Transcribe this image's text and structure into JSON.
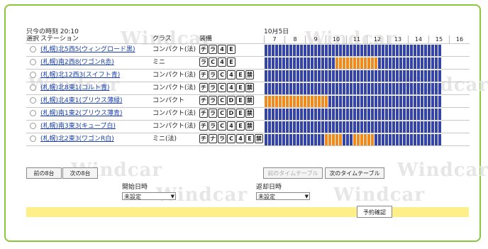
{
  "time_label": "只今の時刻",
  "time_value": "20:10",
  "date_label": "10月5日",
  "headers": {
    "select": "選択",
    "station": "ステーション",
    "class": "クラス",
    "equipment": "装備"
  },
  "hours": [
    "7",
    "8",
    "9",
    "10",
    "11",
    "12",
    "13",
    "14",
    "15",
    "16"
  ],
  "rows": [
    {
      "station": "(札幌)北5西5(ウィングロード黒)",
      "class": "コンパクト(法)",
      "eq": [
        "チ",
        "ラ",
        "4",
        "E"
      ],
      "res": []
    },
    {
      "station": "(札幌)南2西8(ワゴンR赤)",
      "class": "ミニ",
      "eq": [
        "ラ",
        "C",
        "4",
        "E"
      ],
      "res": [
        [
          20,
          32
        ]
      ]
    },
    {
      "station": "(札幌)北12西3(スイフト青)",
      "class": "コンパクト(法)",
      "eq": [
        "チ",
        "ラ",
        "C",
        "4",
        "E",
        "禁"
      ],
      "res": []
    },
    {
      "station": "(札幌)北8東1(コルト青)",
      "class": "コンパクト(法)",
      "eq": [
        "チ",
        "ラ",
        "C",
        "4",
        "E",
        "禁"
      ],
      "res": []
    },
    {
      "station": "(札幌)北4東1(プリウス薄緑)",
      "class": "コンパクト",
      "eq": [
        "チ",
        "ラ",
        "C",
        "D",
        "E",
        "禁"
      ],
      "res": [
        [
          0,
          18
        ]
      ]
    },
    {
      "station": "(札幌)南1東2(プリウス薄青)",
      "class": "コンパクト(法)",
      "eq": [
        "チ",
        "ラ",
        "C",
        "D",
        "E",
        "禁"
      ],
      "res": []
    },
    {
      "station": "(札幌)南3東3(キューブ白)",
      "class": "コンパクト(法)",
      "eq": [
        "チ",
        "ラ",
        "C",
        "4",
        "E",
        "禁"
      ],
      "res": []
    },
    {
      "station": "(札幌)北2東3(ワゴンR白)",
      "class": "ミニ(法)",
      "eq": [
        "チ",
        "ナ",
        "ラ",
        "C",
        "4",
        "E",
        "禁"
      ],
      "res": [
        [
          17,
          22
        ],
        [
          25,
          31
        ]
      ]
    }
  ],
  "buttons": {
    "prev8": "前の8台",
    "next8": "次の8台",
    "prev_tt": "前のタイムテーブル",
    "next_tt": "次のタイムテーブル",
    "confirm": "予約確認"
  },
  "start_label": "開始日時",
  "return_label": "返却日時",
  "start_select": "未設定",
  "return_select": "未設定",
  "watermark": "Windcar",
  "colors": {
    "available": "#3544a8",
    "reserved": "#f08a1c",
    "frame": "#8cc63f",
    "bar": "#ffef8a"
  }
}
